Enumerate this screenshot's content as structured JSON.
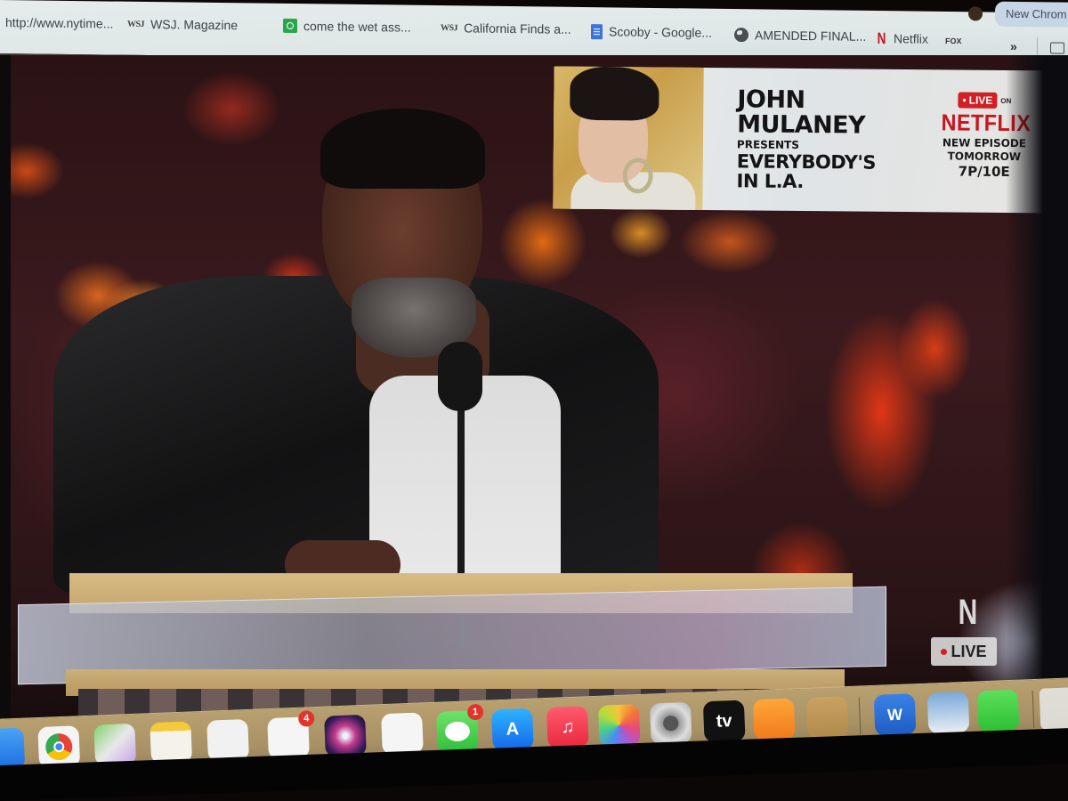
{
  "bookmarks_bar": {
    "items": [
      {
        "label": "http://www.nytime...",
        "icon": "none"
      },
      {
        "label": "WSJ. Magazine",
        "icon": "wsj-icon",
        "icon_text": "WSJ"
      },
      {
        "label": "come the wet ass...",
        "icon": "green-app-icon"
      },
      {
        "label": "California Finds a...",
        "icon": "wsj-icon",
        "icon_text": "WSJ"
      },
      {
        "label": "Scooby - Google...",
        "icon": "google-docs-icon"
      },
      {
        "label": "AMENDED FINAL...",
        "icon": "globe-icon"
      },
      {
        "label": "Netflix",
        "icon": "netflix-icon",
        "icon_text": "N"
      },
      {
        "label": "",
        "icon": "fox-sports-icon",
        "icon_text": "FOX"
      }
    ],
    "overflow_label": "»",
    "new_chrome_label": "New Chrom"
  },
  "video": {
    "banner": {
      "line1": "JOHN",
      "line2": "MULANEY",
      "line3": "PRESENTS",
      "line4": "EVERYBODY'S",
      "line5": "IN L.A.",
      "live_label": "LIVE",
      "live_on": "ON",
      "network": "NETFLIX",
      "episode_line1": "NEW EPISODE",
      "episode_line2": "TOMORROW",
      "episode_time": "7P/10E"
    },
    "bug": {
      "logo": "N",
      "live_label": "LIVE"
    },
    "colors": {
      "netflix_red": "#c8161e",
      "live_red": "#d11f24"
    }
  },
  "dock": {
    "apps": [
      {
        "name": "Mail",
        "icon": "mail-icon"
      },
      {
        "name": "Google Chrome",
        "icon": "chrome-icon"
      },
      {
        "name": "Maps",
        "icon": "maps-icon"
      },
      {
        "name": "Notes",
        "icon": "notes-icon"
      },
      {
        "name": "Freeform",
        "icon": "freeform-icon"
      },
      {
        "name": "Reminders",
        "icon": "reminders-icon",
        "badge": "4"
      },
      {
        "name": "Siri",
        "icon": "siri-icon"
      },
      {
        "name": "News",
        "icon": "news-icon"
      },
      {
        "name": "Messages",
        "icon": "messages-icon",
        "badge": "1"
      },
      {
        "name": "App Store",
        "icon": "app-store-icon"
      },
      {
        "name": "Music",
        "icon": "music-icon"
      },
      {
        "name": "Photos",
        "icon": "photos-icon"
      },
      {
        "name": "System Settings",
        "icon": "settings-icon"
      },
      {
        "name": "Apple TV",
        "icon": "apple-tv-icon",
        "glyph": "tv"
      },
      {
        "name": "Books",
        "icon": "books-icon"
      },
      {
        "name": "Contacts",
        "icon": "contacts-icon"
      },
      {
        "name": "Microsoft Word",
        "icon": "word-icon",
        "glyph": "W"
      },
      {
        "name": "Preview",
        "icon": "preview-icon"
      },
      {
        "name": "FaceTime",
        "icon": "facetime-icon"
      },
      {
        "name": "Trash",
        "icon": "trash-icon"
      }
    ]
  }
}
